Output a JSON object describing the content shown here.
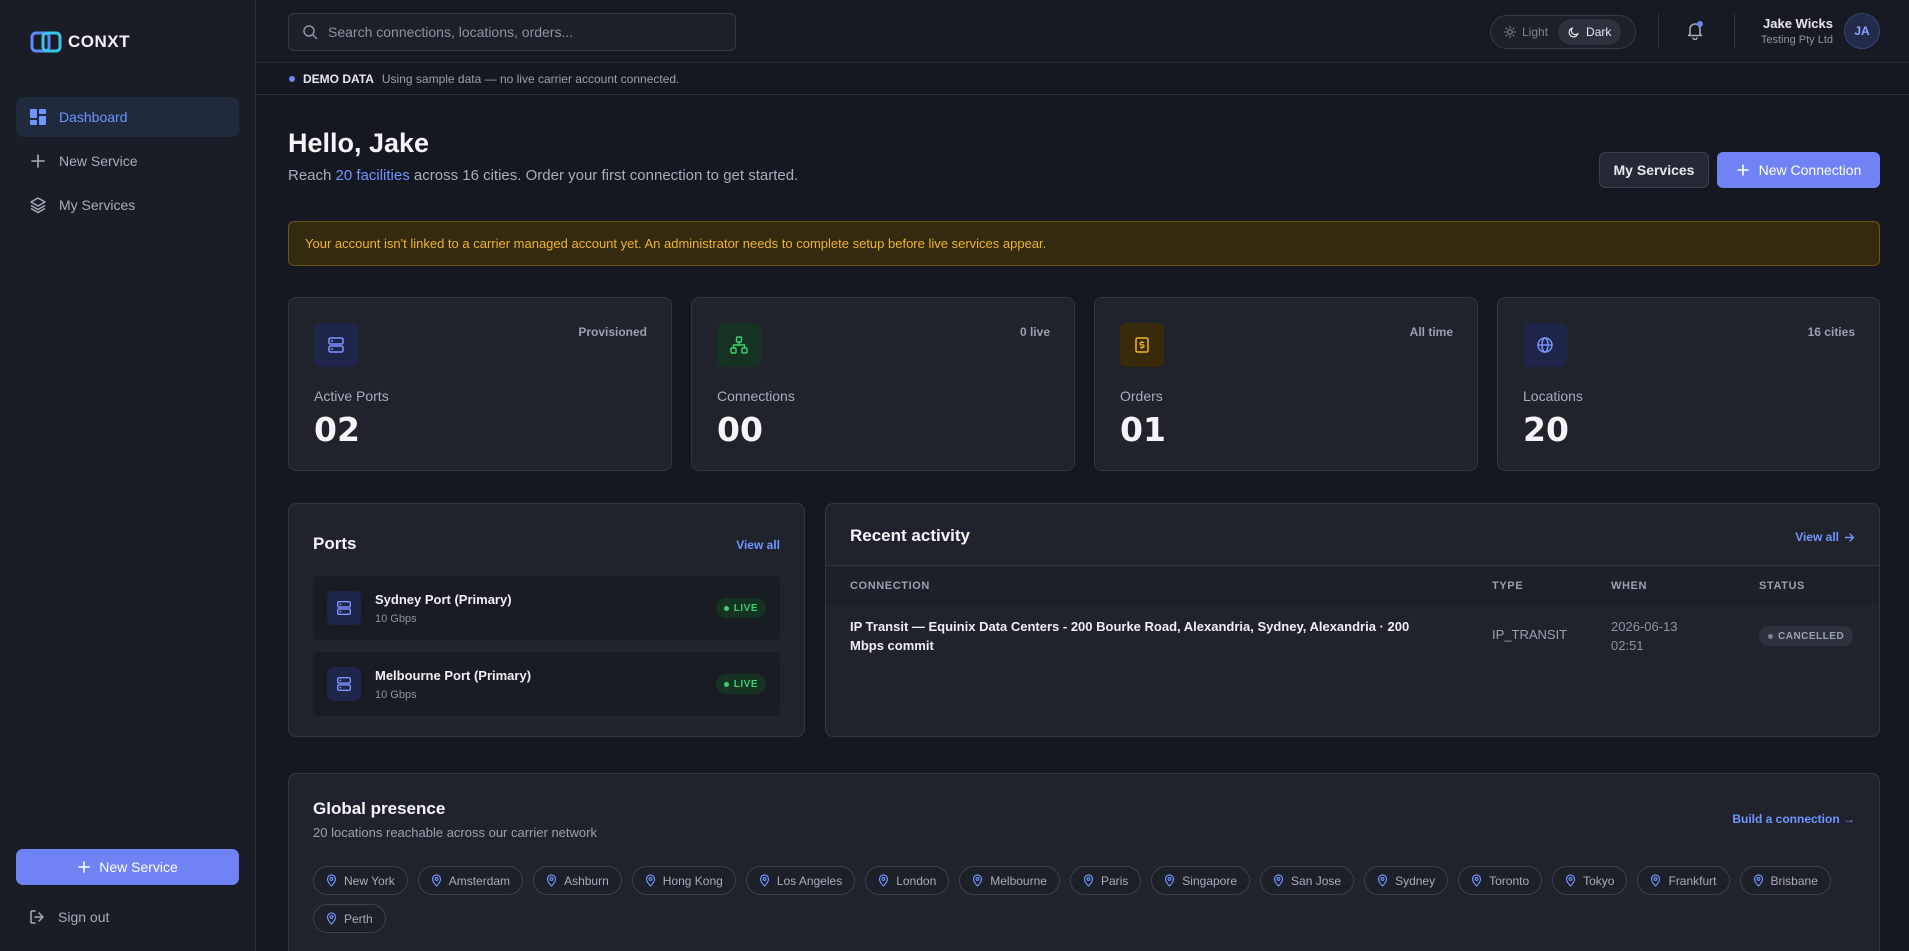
{
  "app": {
    "name": "CONXT"
  },
  "sidebar": {
    "items": [
      {
        "label": "Dashboard",
        "active": true,
        "icon": "dashboard-icon"
      },
      {
        "label": "New Service",
        "active": false,
        "icon": "plus-icon"
      },
      {
        "label": "My Services",
        "active": false,
        "icon": "layers-icon"
      }
    ],
    "cta_label": "New Service",
    "signout_label": "Sign out"
  },
  "topbar": {
    "search_placeholder": "Search connections, locations, orders...",
    "theme": {
      "light_label": "Light",
      "dark_label": "Dark",
      "selected": "Dark"
    },
    "user": {
      "name": "Jake Wicks",
      "org": "Testing Pty Ltd",
      "initials": "JA"
    }
  },
  "demo": {
    "tag": "DEMO DATA",
    "text": "Using sample data — no live carrier account connected."
  },
  "header": {
    "greeting": "Hello, Jake",
    "sub_prefix": "Reach ",
    "sub_highlight": "20 facilities",
    "sub_suffix": " across 16 cities. Order your first connection to get started.",
    "my_services_label": "My Services",
    "new_connection_label": "New Connection"
  },
  "alert": {
    "text": "Your account isn't linked to a carrier managed account yet. An administrator needs to complete setup before live services appear."
  },
  "stats": [
    {
      "label": "Active Ports",
      "value": "02",
      "meta": "Provisioned",
      "icon": "server-icon",
      "bg": "#1f2548",
      "fg": "#7f95ff"
    },
    {
      "label": "Connections",
      "value": "00",
      "meta": "0 live",
      "icon": "network-icon",
      "bg": "#163223",
      "fg": "#3ecf6e"
    },
    {
      "label": "Orders",
      "value": "01",
      "meta": "All time",
      "icon": "receipt-icon",
      "bg": "#3a2a0c",
      "fg": "#f0b429"
    },
    {
      "label": "Locations",
      "value": "20",
      "meta": "16 cities",
      "icon": "globe-icon",
      "bg": "#1f2548",
      "fg": "#7f95ff"
    }
  ],
  "ports": {
    "title": "Ports",
    "view_all": "View all",
    "items": [
      {
        "name": "Sydney Port (Primary)",
        "speed": "10 Gbps",
        "status": "LIVE"
      },
      {
        "name": "Melbourne Port (Primary)",
        "speed": "10 Gbps",
        "status": "LIVE"
      }
    ]
  },
  "activity": {
    "title": "Recent activity",
    "view_all": "View all",
    "columns": [
      "CONNECTION",
      "TYPE",
      "WHEN",
      "STATUS"
    ],
    "rows": [
      {
        "connection_line1": "IP Transit — Equinix Data Centers - 200 Bourke Road, Alexandria, Sydney, Alexandria · 200",
        "connection_line2": "Mbps commit",
        "type": "IP_TRANSIT",
        "when_date": "2026-06-13",
        "when_time": "02:51",
        "status": "CANCELLED"
      }
    ]
  },
  "presence": {
    "title": "Global presence",
    "subtitle": "20 locations reachable across our carrier network",
    "link": "Build a connection →",
    "locations": [
      "New York",
      "Amsterdam",
      "Ashburn",
      "Hong Kong",
      "Los Angeles",
      "London",
      "Melbourne",
      "Paris",
      "Singapore",
      "San Jose",
      "Sydney",
      "Toronto",
      "Tokyo",
      "Frankfurt",
      "Brisbane",
      "Perth"
    ]
  },
  "colors": {
    "accent": "#6f83f5",
    "link": "#6f95ff",
    "warning": "#f0b429",
    "success": "#3ecf6e"
  }
}
